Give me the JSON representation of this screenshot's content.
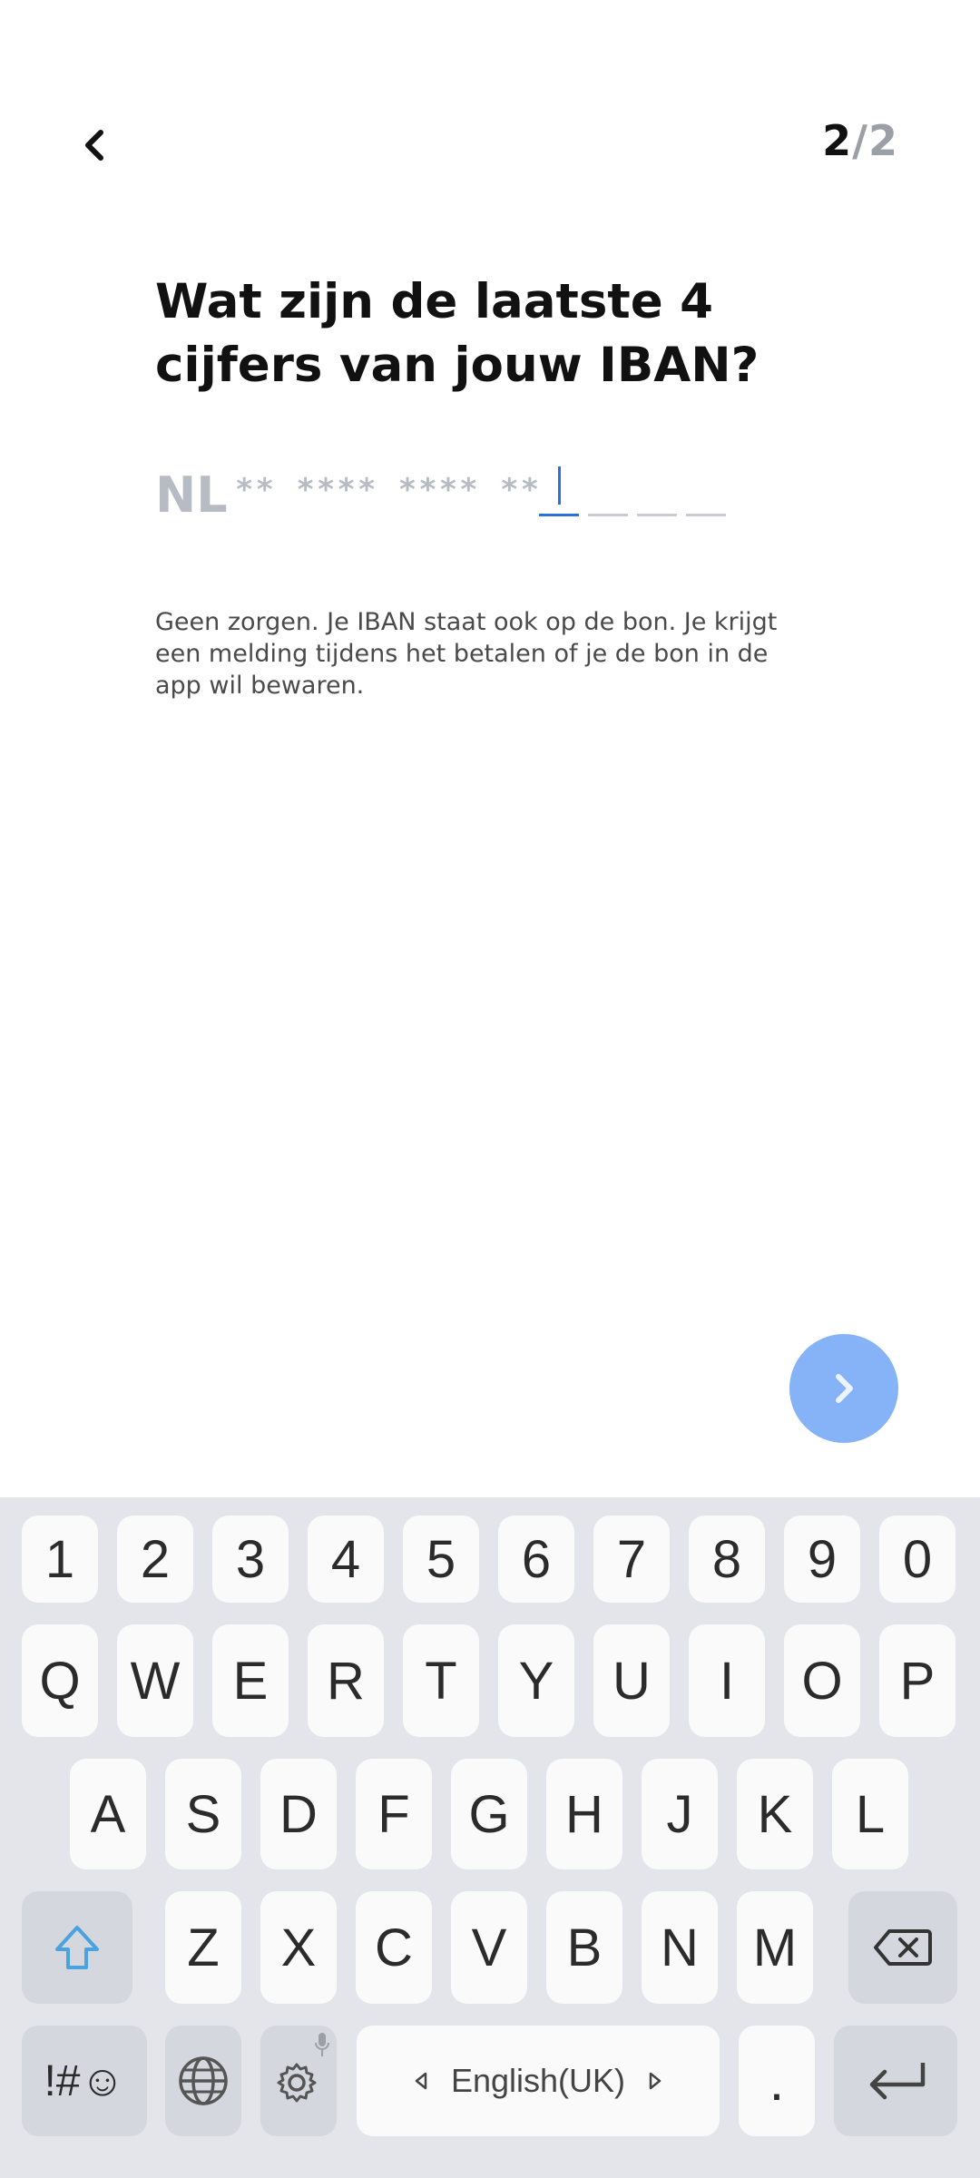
{
  "header": {
    "step_current": "2",
    "step_separator": "/",
    "step_total": "2"
  },
  "title": "Wat zijn de laatste 4 cijfers van jouw IBAN?",
  "iban": {
    "prefix": "NL",
    "mask": "** **** **** **",
    "digits": [
      "",
      "",
      "",
      ""
    ]
  },
  "hint": "Geen zorgen. Je IBAN staat ook op de bon. Je krijgt een melding tijdens het betalen of je de bon in de app wil bewaren.",
  "keyboard": {
    "row_numbers": [
      "1",
      "2",
      "3",
      "4",
      "5",
      "6",
      "7",
      "8",
      "9",
      "0"
    ],
    "row1": [
      "Q",
      "W",
      "E",
      "R",
      "T",
      "Y",
      "U",
      "I",
      "O",
      "P"
    ],
    "row2": [
      "A",
      "S",
      "D",
      "F",
      "G",
      "H",
      "J",
      "K",
      "L"
    ],
    "row3": [
      "Z",
      "X",
      "C",
      "V",
      "B",
      "N",
      "M"
    ],
    "symbols_label": "!#☺",
    "language_label": "English(UK)",
    "period_label": "."
  },
  "colors": {
    "accent": "#2b6fe0",
    "next_button": "#86b3f7",
    "keyboard_bg": "#e3e5ea"
  },
  "icons": {
    "back": "chevron-left-icon",
    "next": "chevron-right-icon"
  }
}
